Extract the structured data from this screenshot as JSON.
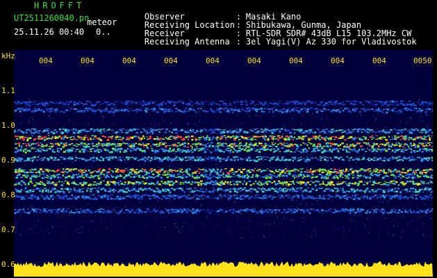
{
  "header": {
    "brand": "HROFFT",
    "filename": "UT2511260040.pn",
    "meteor_label": "meteor",
    "datetime": "25.11.26 00:40",
    "datetime_extra": "0..",
    "info": [
      {
        "label": "Observer",
        "value": "Masaki Kano"
      },
      {
        "label": "Receiving Location",
        "value": "Shibukawa, Gunma, Japan"
      },
      {
        "label": "Receiver",
        "value": "RTL-SDR SDR# 43dB L15 103.2MHz CW"
      },
      {
        "label": "Receiving Antenna",
        "value": "3el Yagi(V) Az 330 for Vladivostok"
      }
    ]
  },
  "axis": {
    "unit": "kHz",
    "y_ticks": [
      "1.1",
      "1.0",
      "0.9",
      "0.8",
      "0.7",
      "0.6"
    ],
    "x_ticks": [
      "004",
      "004",
      "004",
      "004",
      "004",
      "004",
      "004",
      "004",
      "004",
      "0050"
    ]
  },
  "colors": {
    "background": "#000000",
    "plot_background": "#00003a",
    "text_white": "#ffffff",
    "text_yellow": "#ffe21a",
    "text_green": "#33e633",
    "signal_band": "#ffe21a"
  },
  "spectrogram": {
    "bands": [
      {
        "freq": 1.065,
        "strength": 0.25
      },
      {
        "freq": 1.045,
        "strength": 0.3
      },
      {
        "freq": 0.985,
        "strength": 0.45
      },
      {
        "freq": 0.965,
        "strength": 0.9
      },
      {
        "freq": 0.945,
        "strength": 0.8
      },
      {
        "freq": 0.93,
        "strength": 0.55
      },
      {
        "freq": 0.905,
        "strength": 0.5
      },
      {
        "freq": 0.87,
        "strength": 0.85
      },
      {
        "freq": 0.855,
        "strength": 0.6
      },
      {
        "freq": 0.835,
        "strength": 0.75
      },
      {
        "freq": 0.815,
        "strength": 0.5
      },
      {
        "freq": 0.795,
        "strength": 0.3
      },
      {
        "freq": 0.755,
        "strength": 0.3
      }
    ]
  }
}
